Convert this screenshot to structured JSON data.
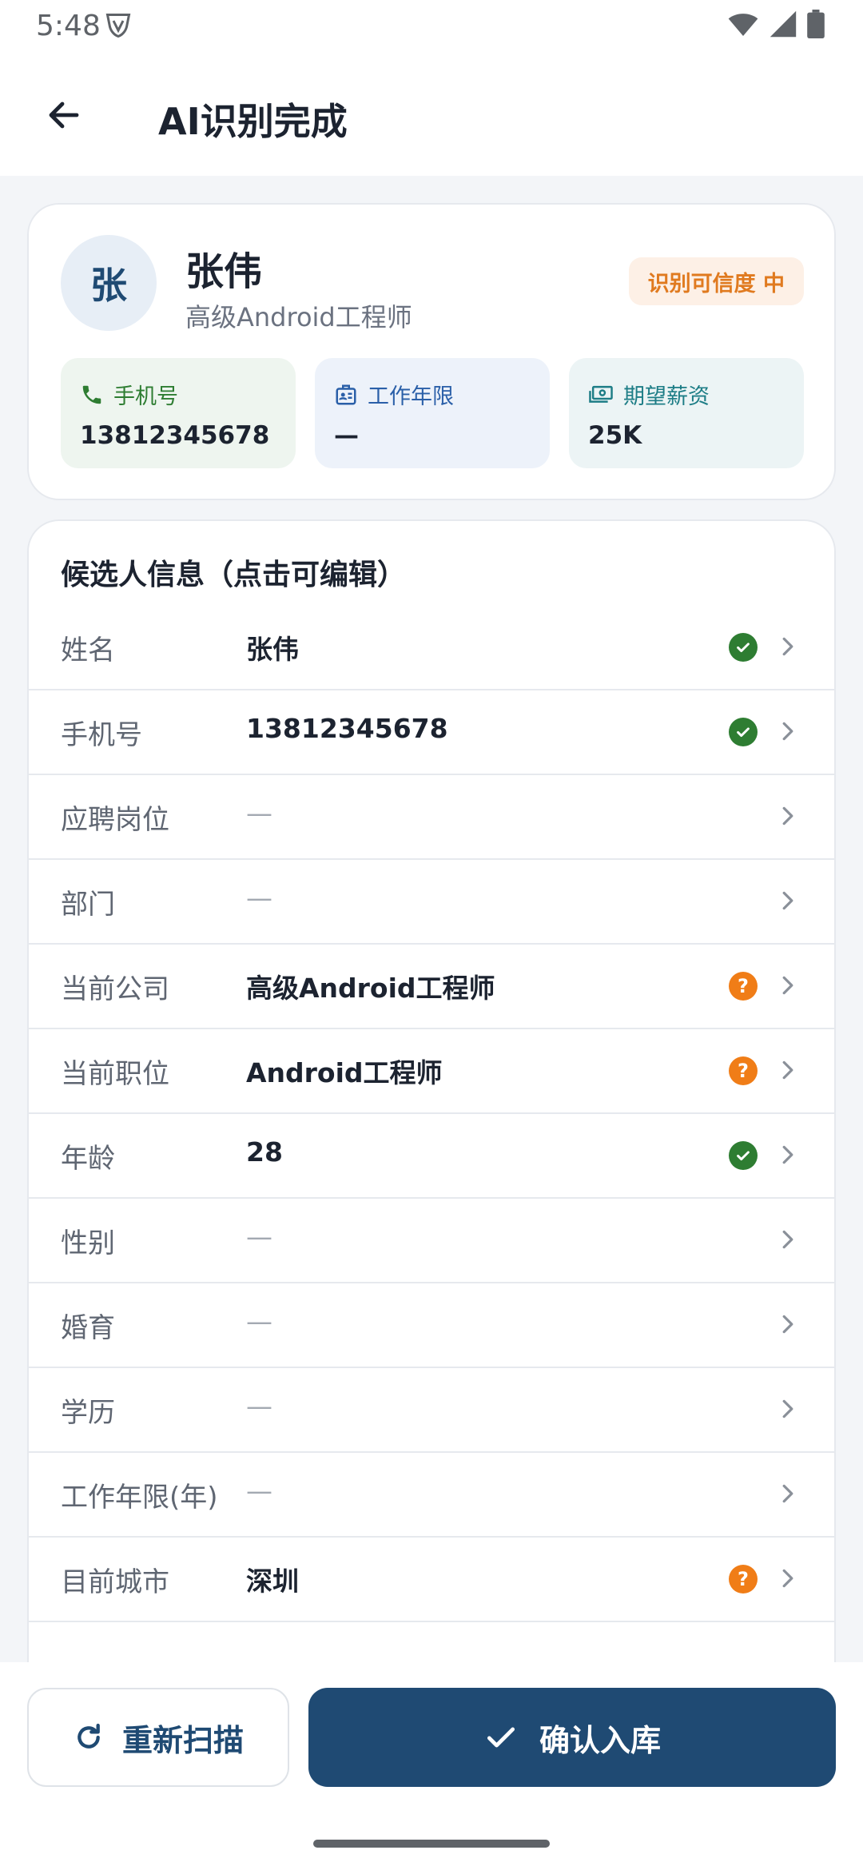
{
  "status_bar": {
    "time": "5:48"
  },
  "app_bar": {
    "title": "AI识别完成"
  },
  "profile": {
    "avatar_char": "张",
    "name": "张伟",
    "subtitle": "高级Android工程师",
    "confidence_badge": "识别可信度 中",
    "stats": [
      {
        "label": "手机号",
        "value": "13812345678",
        "icon": "phone-icon"
      },
      {
        "label": "工作年限",
        "value": "—",
        "icon": "id-badge-icon"
      },
      {
        "label": "期望薪资",
        "value": "25K",
        "icon": "money-icon"
      }
    ]
  },
  "info": {
    "section_title": "候选人信息（点击可编辑）",
    "rows": [
      {
        "label": "姓名",
        "value": "张伟",
        "status": "ok"
      },
      {
        "label": "手机号",
        "value": "13812345678",
        "status": "ok"
      },
      {
        "label": "应聘岗位",
        "value": "—",
        "status": "none"
      },
      {
        "label": "部门",
        "value": "—",
        "status": "none"
      },
      {
        "label": "当前公司",
        "value": "高级Android工程师",
        "status": "warn"
      },
      {
        "label": "当前职位",
        "value": "Android工程师",
        "status": "warn"
      },
      {
        "label": "年龄",
        "value": "28",
        "status": "ok"
      },
      {
        "label": "性别",
        "value": "—",
        "status": "none"
      },
      {
        "label": "婚育",
        "value": "—",
        "status": "none"
      },
      {
        "label": "学历",
        "value": "—",
        "status": "none"
      },
      {
        "label": "工作年限(年)",
        "value": "—",
        "status": "none"
      },
      {
        "label": "目前城市",
        "value": "深圳",
        "status": "warn"
      }
    ]
  },
  "actions": {
    "rescan_label": "重新扫描",
    "confirm_label": "确认入库"
  },
  "colors": {
    "primary": "#1f4a73",
    "ok": "#2e7d32",
    "warn": "#f07d17",
    "confidence_text": "#e07a1f"
  }
}
